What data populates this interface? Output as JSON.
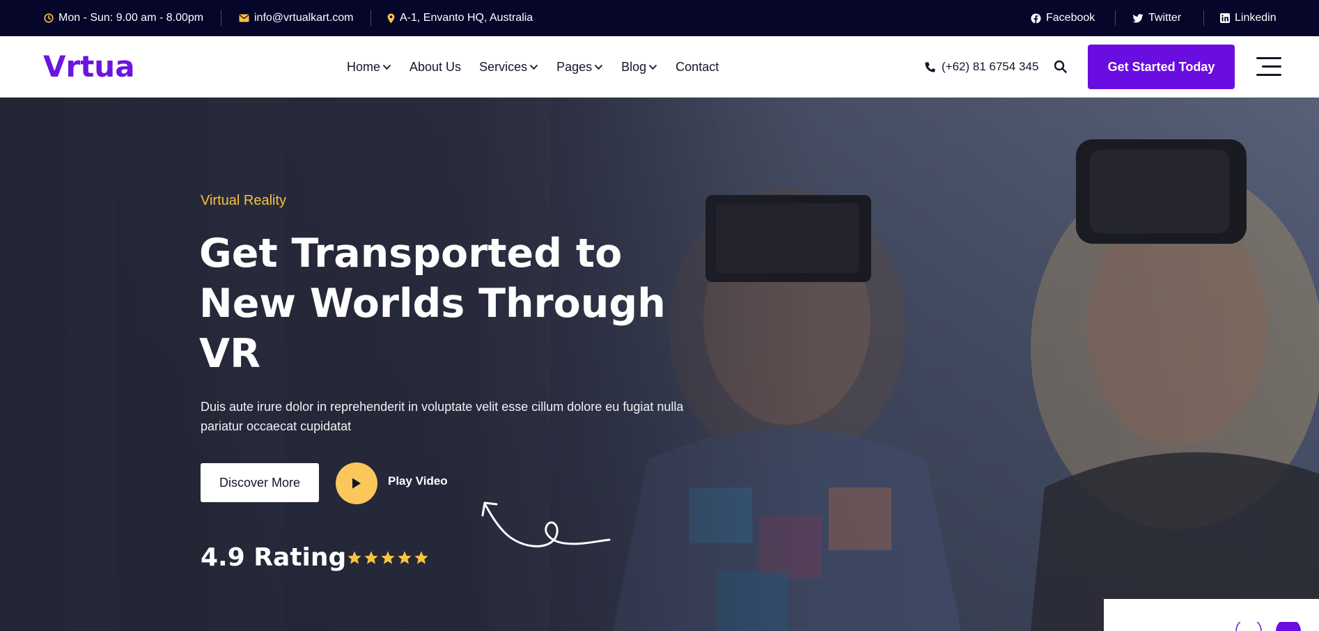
{
  "topbar": {
    "hours": "Mon - Sun: 9.00 am - 8.00pm",
    "email": "info@vrtualkart.com",
    "address": "A-1, Envanto HQ, Australia",
    "social": [
      "Facebook",
      "Twitter",
      "Linkedin"
    ]
  },
  "header": {
    "logo": "Vrtua",
    "nav": [
      "Home",
      "About Us",
      "Services",
      "Pages",
      "Blog",
      "Contact"
    ],
    "phone": "(+62) 81 6754 345",
    "cta": "Get Started Today"
  },
  "hero": {
    "eyebrow": "Virtual Reality",
    "headline": "Get Transported to New Worlds Through VR",
    "description": "Duis aute irure dolor in reprehenderit in voluptate velit esse cillum dolore eu fugiat nulla pariatur occaecat cupidatat",
    "discover_button": "Discover More",
    "play_label": "Play Video",
    "rating_text": "4.9 Rating",
    "stars": 5
  },
  "colors": {
    "topbar_bg": "#06052a",
    "brand_purple": "#6a0de0",
    "accent_yellow": "#f9c240",
    "play_button": "#fbc75b"
  },
  "icons": {
    "hours": "clock-icon",
    "email": "envelope-icon",
    "address": "map-pin-icon",
    "facebook": "facebook-icon",
    "twitter": "twitter-icon",
    "linkedin": "linkedin-icon",
    "phone": "phone-icon",
    "search": "search-icon",
    "menu": "hamburger-menu-icon",
    "play": "play-icon",
    "star": "star-icon"
  }
}
